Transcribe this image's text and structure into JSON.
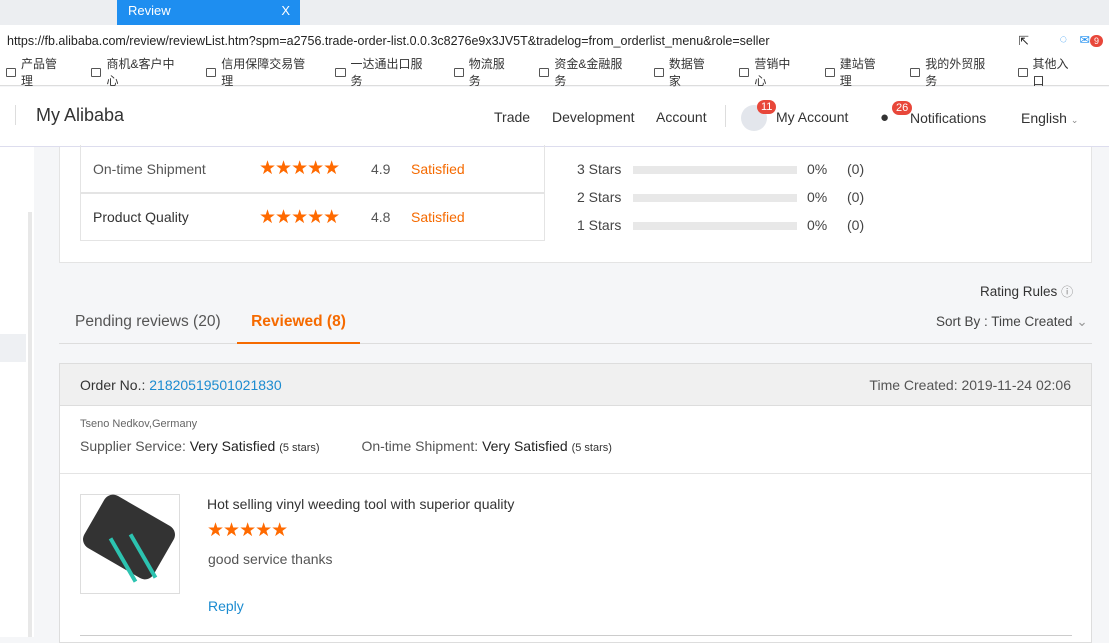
{
  "browser": {
    "tab_title": "Review",
    "close": "X",
    "url": "https://fb.alibaba.com/review/reviewList.htm?spm=a2756.trade-order-list.0.0.3c8276e9x3JV5T&tradelog=from_orderlist_menu&role=seller",
    "mail_count": "9"
  },
  "bookmarks": [
    "产品管理",
    "商机&客户中心",
    "信用保障交易管理",
    "一达通出口服务",
    "物流服务",
    "资金&金融服务",
    "数据管家",
    "营销中心",
    "建站管理",
    "我的外贸服务",
    "其他入口"
  ],
  "header": {
    "logo": "My Alibaba",
    "nav": [
      "Trade",
      "Development",
      "Account"
    ],
    "my_account": "My Account",
    "account_badge": "11",
    "notifications": "Notifications",
    "notif_badge": "26",
    "language": "English"
  },
  "ratings": [
    {
      "label": "On-time Shipment",
      "stars": "★★★★★",
      "score": "4.9",
      "status": "Satisfied"
    },
    {
      "label": "Product Quality",
      "stars": "★★★★★",
      "score": "4.8",
      "status": "Satisfied"
    }
  ],
  "distribution": [
    {
      "label": "3  Stars",
      "percent": "0%",
      "count": "(0)",
      "fraction": 0
    },
    {
      "label": "2  Stars",
      "percent": "0%",
      "count": "(0)",
      "fraction": 0
    },
    {
      "label": "1  Stars",
      "percent": "0%",
      "count": "(0)",
      "fraction": 0
    }
  ],
  "rating_rules": "Rating Rules",
  "tabs": [
    {
      "label": "Pending reviews (20)"
    },
    {
      "label": "Reviewed (8)"
    }
  ],
  "sort": "Sort By : Time Created",
  "order": {
    "no_label": "Order No.: ",
    "no": "21820519501021830",
    "time": "Time Created: 2019-11-24 02:06",
    "buyer": "Tseno Nedkov,Germany",
    "supplier_label": "Supplier Service: ",
    "supplier_value": "Very Satisfied",
    "supplier_stars": "(5 stars)",
    "ship_label": "On-time Shipment: ",
    "ship_value": "Very Satisfied",
    "ship_stars": "(5 stars)"
  },
  "product": {
    "title": "Hot selling vinyl weeding tool with superior quality",
    "stars": "★★★★★",
    "comment": "good service thanks",
    "reply": "Reply"
  }
}
